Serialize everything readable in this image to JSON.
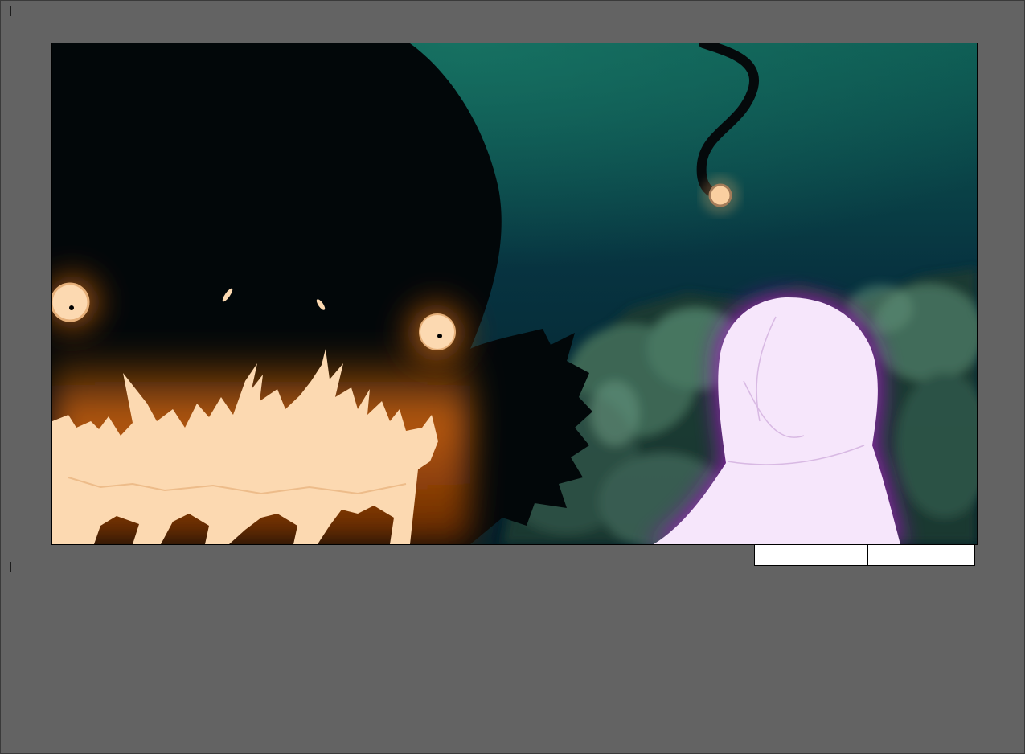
{
  "canvas": {
    "background_color": "#636363",
    "frame_border_color": "#000000"
  },
  "panel": {
    "scene": {
      "sky_top_color": "#0d5a52",
      "sky_bottom_color": "#03202a",
      "monster_color": "#020709",
      "fire_color": "#fcd9b1",
      "fire_glow_color": "#e06f10",
      "ghost_color": "#f6e6fb",
      "ghost_aura_color": "#9b1fb8",
      "foliage_color": "#2b4a3e"
    }
  },
  "slate": {
    "left_label": "",
    "right_label": ""
  }
}
